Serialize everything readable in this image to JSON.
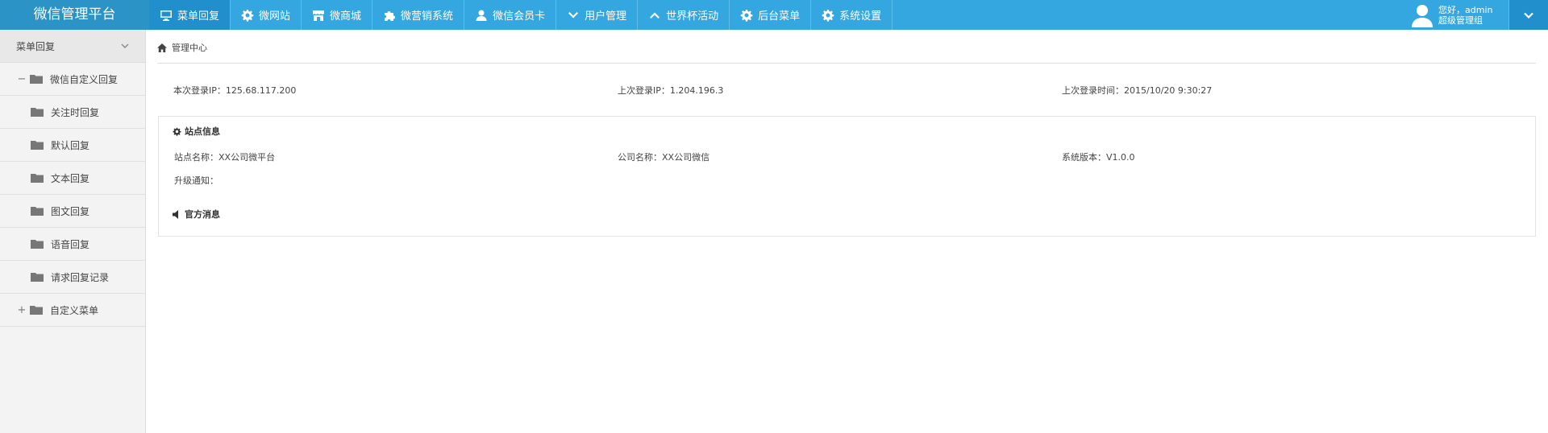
{
  "app": {
    "title": "微信管理平台"
  },
  "nav": {
    "items": [
      {
        "label": "菜单回复",
        "icon": "monitor-icon",
        "active": true
      },
      {
        "label": "微网站",
        "icon": "gear-icon"
      },
      {
        "label": "微商城",
        "icon": "store-icon"
      },
      {
        "label": "微营销系统",
        "icon": "puzzle-icon"
      },
      {
        "label": "微信会员卡",
        "icon": "user-icon"
      },
      {
        "label": "用户管理",
        "icon": "chevron-down-icon"
      },
      {
        "label": "世界杯活动",
        "icon": "chevron-up-icon"
      },
      {
        "label": "后台菜单",
        "icon": "gear-icon"
      },
      {
        "label": "系统设置",
        "icon": "gear-icon"
      }
    ]
  },
  "user": {
    "greeting": "您好，admin",
    "role": "超级管理组"
  },
  "sidebar": {
    "header": "菜单回复",
    "groups": [
      {
        "label": "微信自定义回复",
        "toggle": "−",
        "expanded": true,
        "children": [
          "关注时回复",
          "默认回复",
          "文本回复",
          "图文回复",
          "语音回复",
          "请求回复记录"
        ]
      },
      {
        "label": "自定义菜单",
        "toggle": "+",
        "expanded": false
      }
    ]
  },
  "breadcrumb": {
    "label": "管理中心"
  },
  "login": {
    "current_ip": "本次登录IP：125.68.117.200",
    "last_ip": "上次登录IP：1.204.196.3",
    "last_time": "上次登录时间：2015/10/20 9:30:27"
  },
  "site_info": {
    "title": "站点信息",
    "site_name": "站点名称：XX公司微平台",
    "company": "公司名称：XX公司微信",
    "version": "系统版本：V1.0.0",
    "upgrade": "升级通知："
  },
  "official": {
    "title": "官方消息"
  },
  "colors": {
    "topbar": "#35a7e0",
    "logo_bg": "#2b93c6",
    "active": "#208fcb"
  }
}
